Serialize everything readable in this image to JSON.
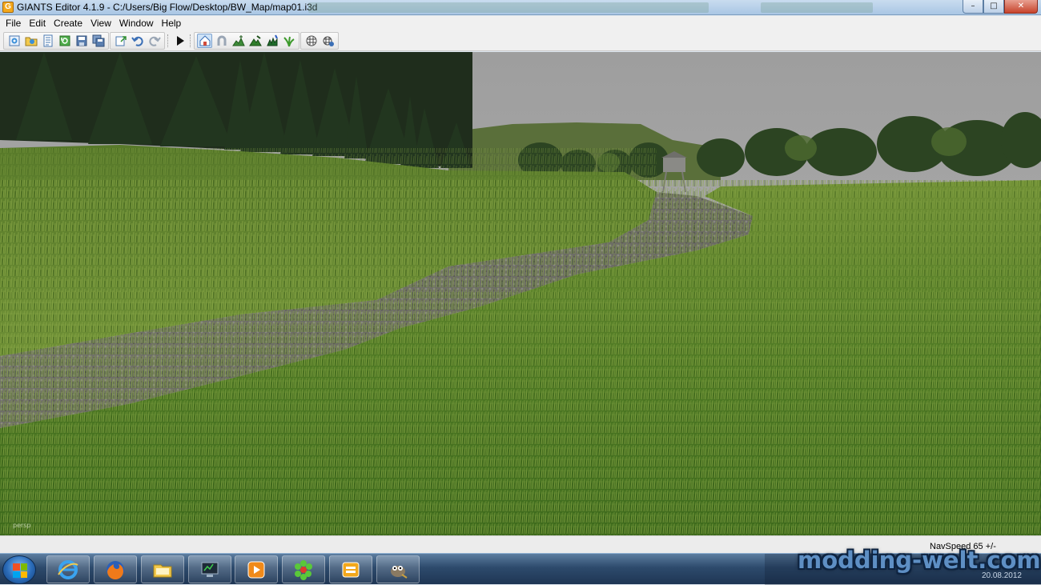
{
  "window": {
    "title": "GIANTS Editor 4.1.9 - C:/Users/Big Flow/Desktop/BW_Map/map01.i3d",
    "app_icon_letter": "G",
    "minimize_label": "–",
    "maximize_label": "□",
    "close_label": "✕"
  },
  "menu": {
    "items": [
      {
        "label": "File"
      },
      {
        "label": "Edit"
      },
      {
        "label": "Create"
      },
      {
        "label": "View"
      },
      {
        "label": "Window"
      },
      {
        "label": "Help"
      }
    ]
  },
  "toolbar": {
    "buttons": [
      {
        "icon": "new-scene-icon"
      },
      {
        "icon": "open-icon"
      },
      {
        "icon": "properties-icon"
      },
      {
        "icon": "reload-icon"
      },
      {
        "icon": "save-icon"
      },
      {
        "icon": "save-all-icon"
      },
      {
        "icon": "export-icon"
      },
      {
        "icon": "undo-icon"
      },
      {
        "icon": "redo-icon"
      },
      {
        "icon": "play-icon"
      },
      {
        "icon": "select-mode-icon",
        "active": true
      },
      {
        "icon": "magnet-icon"
      },
      {
        "icon": "terrain-sculpt-icon"
      },
      {
        "icon": "terrain-paint-icon"
      },
      {
        "icon": "foliage-paint-icon"
      },
      {
        "icon": "grass-paint-icon"
      },
      {
        "icon": "snap-icon"
      },
      {
        "icon": "snap-settings-icon"
      }
    ]
  },
  "viewport": {
    "camera_label": "persp"
  },
  "status": {
    "navspeed": "NavSpeed 65 +/-"
  },
  "taskbar": {
    "apps": [
      {
        "icon": "internet-explorer-icon"
      },
      {
        "icon": "firefox-icon"
      },
      {
        "icon": "file-explorer-icon"
      },
      {
        "icon": "computer-monitor-icon"
      },
      {
        "icon": "media-player-icon"
      },
      {
        "icon": "icq-icon"
      },
      {
        "icon": "giants-editor-icon"
      },
      {
        "icon": "gimp-icon"
      }
    ],
    "date": "20.08.2012"
  },
  "watermark": {
    "text": "modding-welt.com"
  }
}
